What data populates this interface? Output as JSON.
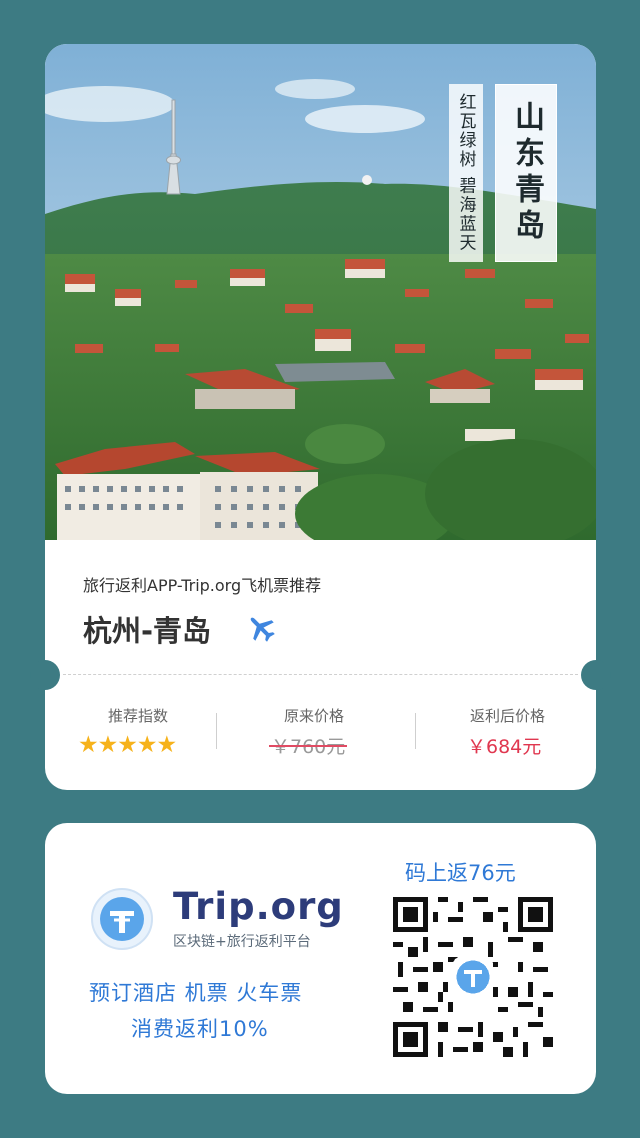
{
  "poster": {
    "photo_alt": "Qingdao cityscape",
    "title_vertical": "山东青岛",
    "subtitle_vertical": "红瓦绿树 碧海蓝天"
  },
  "ticket": {
    "caption": "旅行返利APP-Trip.org飞机票推荐",
    "route": "杭州-青岛",
    "plane_icon": "airplane-icon",
    "recommend_label": "推荐指数",
    "stars": "★★★★★",
    "rating": 5,
    "original_label": "原来价格",
    "original_price": "￥760元",
    "rebate_label": "返利后价格",
    "rebate_price": "￥684元"
  },
  "promo": {
    "brand": "Trip.org",
    "brand_sub": "区块链+旅行返利平台",
    "line1": "预订酒店 机票 火车票",
    "line2": "消费返利10%",
    "qr_title": "码上返76元"
  },
  "colors": {
    "background": "#3d7b83",
    "accent_blue": "#2f79d6",
    "price_red": "#e0374f",
    "star_yellow": "#f6b21b",
    "brand_navy": "#2d3c7a"
  }
}
